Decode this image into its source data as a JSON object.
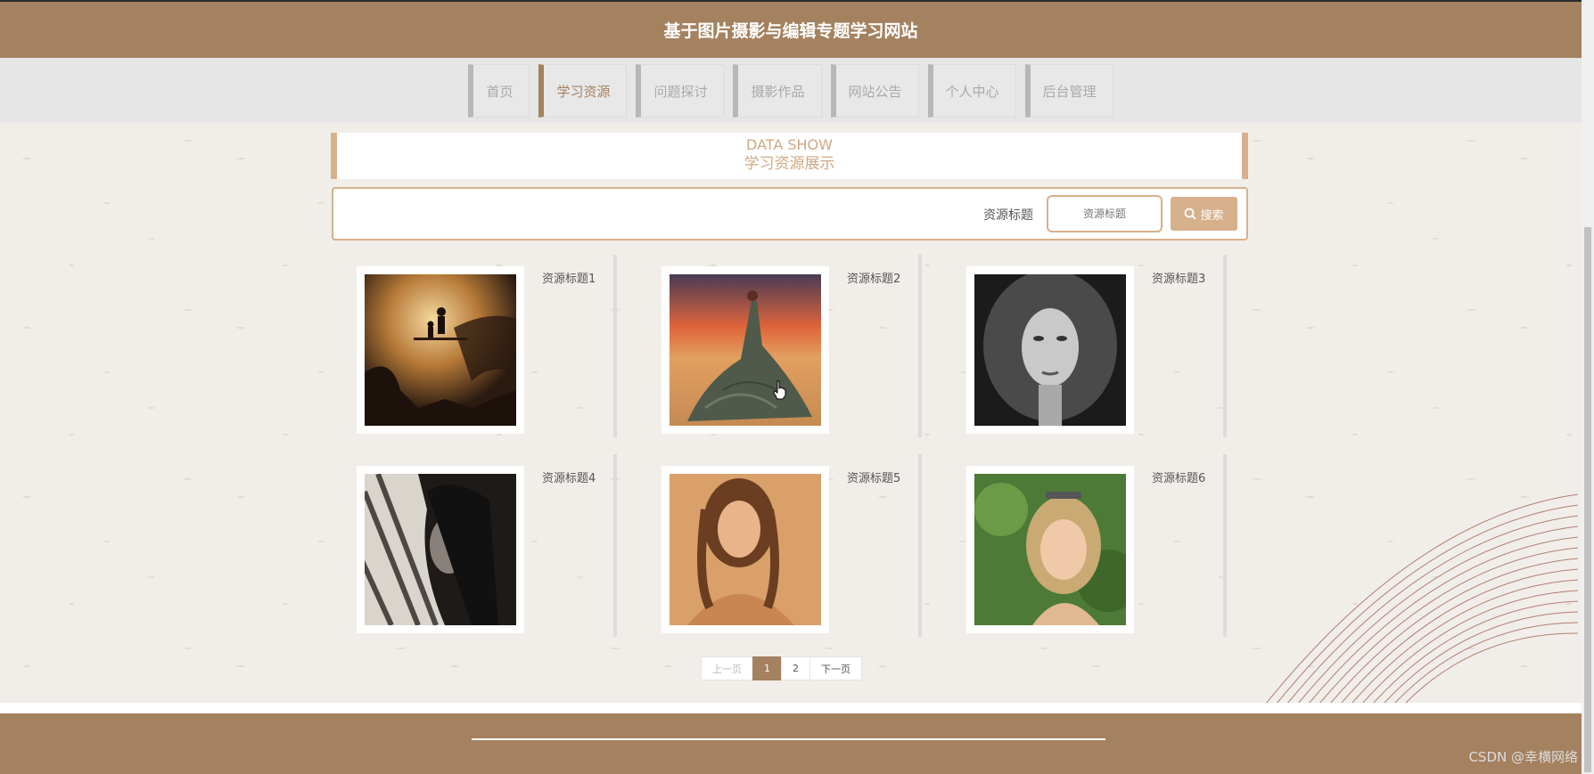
{
  "header": {
    "title": "基于图片摄影与编辑专题学习网站"
  },
  "nav": {
    "items": [
      {
        "label": "首页"
      },
      {
        "label": "学习资源",
        "active": true
      },
      {
        "label": "问题探讨"
      },
      {
        "label": "摄影作品"
      },
      {
        "label": "网站公告"
      },
      {
        "label": "个人中心"
      },
      {
        "label": "后台管理"
      }
    ]
  },
  "section": {
    "en_title": "DATA SHOW",
    "cn_title": "学习资源展示"
  },
  "search": {
    "label": "资源标题",
    "placeholder": "资源标题",
    "button_label": "搜索"
  },
  "resources": [
    {
      "title": "资源标题1",
      "image": "silhouette-cave-photo"
    },
    {
      "title": "资源标题2",
      "image": "woman-gown-desert-photo"
    },
    {
      "title": "资源标题3",
      "image": "bw-curly-hair-portrait"
    },
    {
      "title": "资源标题4",
      "image": "bw-shadow-portrait"
    },
    {
      "title": "资源标题5",
      "image": "warm-tone-portrait"
    },
    {
      "title": "资源标题6",
      "image": "blonde-outdoor-portrait"
    }
  ],
  "pagination": {
    "prev": "上一页",
    "pages": [
      "1",
      "2"
    ],
    "current": "1",
    "next": "下一页"
  },
  "watermark": "CSDN @幸横网络",
  "colors": {
    "brand": "#a4815f",
    "accent": "#d7b08c",
    "nav_bg": "#e6e6e6"
  }
}
